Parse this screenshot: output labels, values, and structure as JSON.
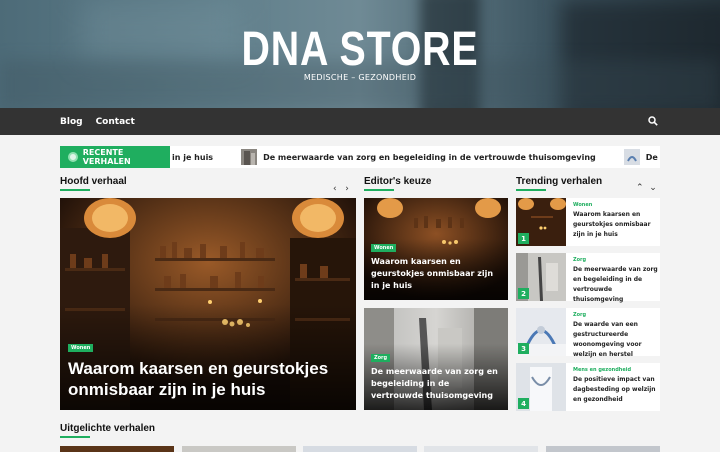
{
  "site": {
    "title": "DNA STORE",
    "tagline": "MEDISCHE – GEZONDHEID"
  },
  "nav": {
    "items": [
      "Blog",
      "Contact"
    ]
  },
  "ticker": {
    "label": "RECENTE VERHALEN",
    "items": [
      "in je huis",
      "De meerwaarde van zorg en begeleiding in de vertrouwde thuisomgeving",
      "De waarde van"
    ]
  },
  "sections": {
    "main": "Hoofd verhaal",
    "editors": "Editor's keuze",
    "trending": "Trending verhalen",
    "featured": "Uitgelichte verhalen"
  },
  "main_story": {
    "category": "Wonen",
    "title": "Waarom kaarsen en geurstokjes onmisbaar zijn in je huis"
  },
  "editors_pick": [
    {
      "category": "Wonen",
      "title": "Waarom kaarsen en geurstokjes onmisbaar zijn in je huis"
    },
    {
      "category": "Zorg",
      "title": "De meerwaarde van zorg en begeleiding in de vertrouwde thuisomgeving"
    }
  ],
  "trending": [
    {
      "num": "1",
      "category": "Wonen",
      "title": "Waarom kaarsen en geurstokjes onmisbaar zijn in je huis"
    },
    {
      "num": "2",
      "category": "Zorg",
      "title": "De meerwaarde van zorg en begeleiding in de vertrouwde thuisomgeving"
    },
    {
      "num": "3",
      "category": "Zorg",
      "title": "De waarde van een gestructureerde woonomgeving voor welzijn en herstel"
    },
    {
      "num": "4",
      "category": "Mens en gezondheid",
      "title": "De positieve impact van dagbesteding op welzijn en gezondheid"
    }
  ],
  "colors": {
    "accent": "#1fae5f",
    "nav_bg": "#333333"
  }
}
